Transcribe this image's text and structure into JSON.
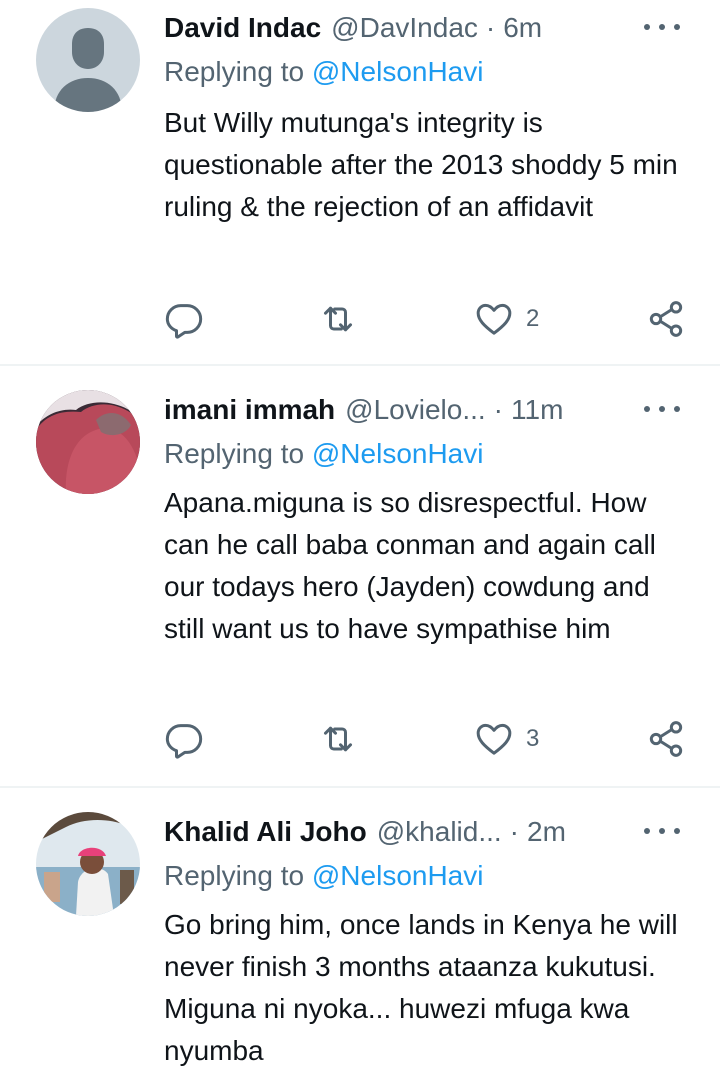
{
  "tweets": [
    {
      "name": "David Indac",
      "handle": "@DavIndac",
      "separator": "·",
      "time": "6m",
      "replying_prefix": "Replying to",
      "replying_to": "@NelsonHavi",
      "text": "But Willy mutunga's integrity is questionable after the 2013 shoddy 5 min ruling & the rejection of an affidavit",
      "likes": "2"
    },
    {
      "name": "imani immah",
      "handle": "@Lovielo...",
      "separator": "·",
      "time": "11m",
      "replying_prefix": "Replying to",
      "replying_to": "@NelsonHavi",
      "text": "Apana.miguna is so disrespectful. How can he call baba conman and again call our todays hero (Jayden) cowdung and still want us to have sympathise him",
      "likes": "3"
    },
    {
      "name": "Khalid Ali Joho",
      "handle": "@khalid...",
      "separator": "·",
      "time": "2m",
      "replying_prefix": "Replying to",
      "replying_to": "@NelsonHavi",
      "text": "Go bring him, once lands in Kenya he will never finish 3 months ataanza kukutusi. Miguna ni nyoka... huwezi mfuga kwa nyumba"
    }
  ],
  "icons": {
    "reply": "reply-icon",
    "retweet": "retweet-icon",
    "like": "like-icon",
    "share": "share-icon",
    "more": "more-icon"
  },
  "colors": {
    "text": "#0f1419",
    "secondary": "#536471",
    "link": "#1d9bf0",
    "divider": "#eff3f4"
  }
}
